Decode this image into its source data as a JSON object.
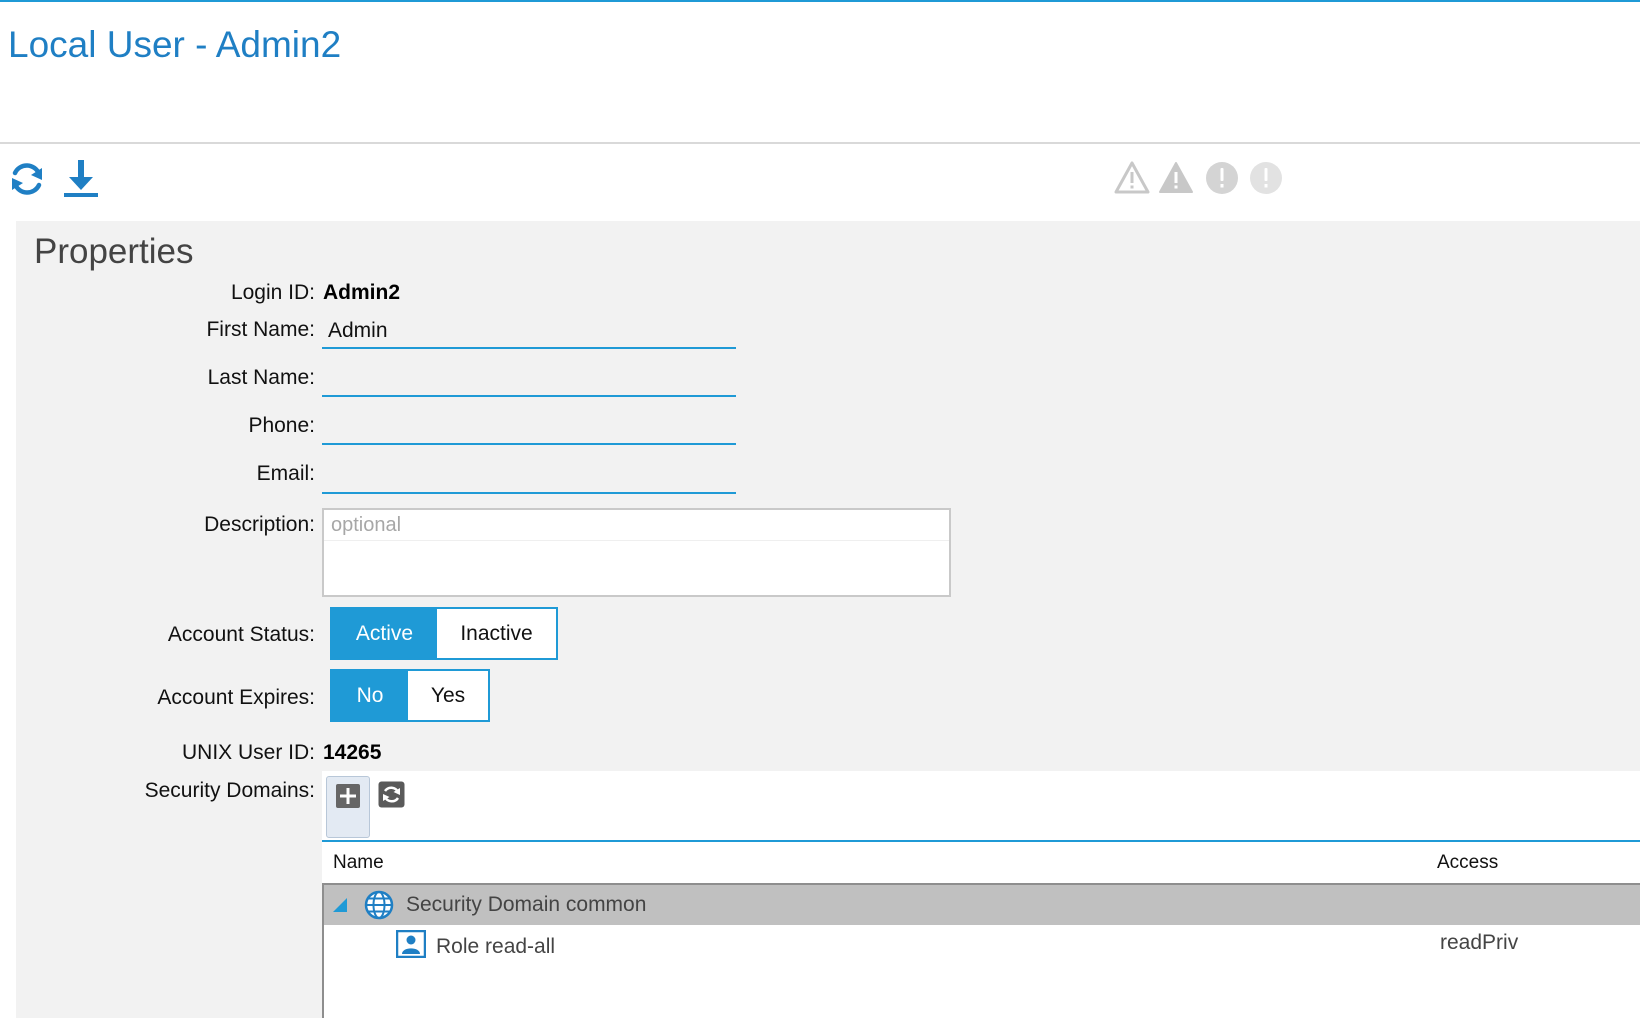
{
  "header": {
    "title": "Local User - Admin2"
  },
  "toolbar": {
    "actions": [
      {
        "icon": "refresh-icon",
        "name": "refresh-button"
      },
      {
        "icon": "download-icon",
        "name": "download-button"
      }
    ],
    "fault_counters": [
      "critical-fault-icon",
      "major-fault-icon",
      "minor-fault-icon",
      "warning-fault-icon"
    ]
  },
  "properties": {
    "title": "Properties",
    "login_id_label": "Login ID:",
    "login_id": "Admin2",
    "first_name_label": "First Name:",
    "first_name": "Admin",
    "last_name_label": "Last Name:",
    "last_name": "",
    "phone_label": "Phone:",
    "phone": "",
    "email_label": "Email:",
    "email": "",
    "description_label": "Description:",
    "description": "",
    "description_placeholder": "optional",
    "account_status_label": "Account Status:",
    "account_status_options": [
      "Active",
      "Inactive"
    ],
    "account_status_selected": "Active",
    "account_expires_label": "Account Expires:",
    "account_expires_options": [
      "No",
      "Yes"
    ],
    "account_expires_selected": "No",
    "unix_user_id_label": "UNIX User ID:",
    "unix_user_id": "14265",
    "security_domains_label": "Security Domains:"
  },
  "security_domains": {
    "columns": [
      "Name",
      "Access"
    ],
    "rows": [
      {
        "type": "group",
        "icon": "globe-icon",
        "name": "Security Domain common",
        "access": ""
      },
      {
        "type": "child",
        "icon": "user-role-icon",
        "name": "Role read-all",
        "access": "readPriv"
      }
    ]
  },
  "colors": {
    "accent": "#1f9ad6",
    "title": "#1f7fc4",
    "panel": "#f2f2f2",
    "group_row": "#c0c0c0"
  }
}
